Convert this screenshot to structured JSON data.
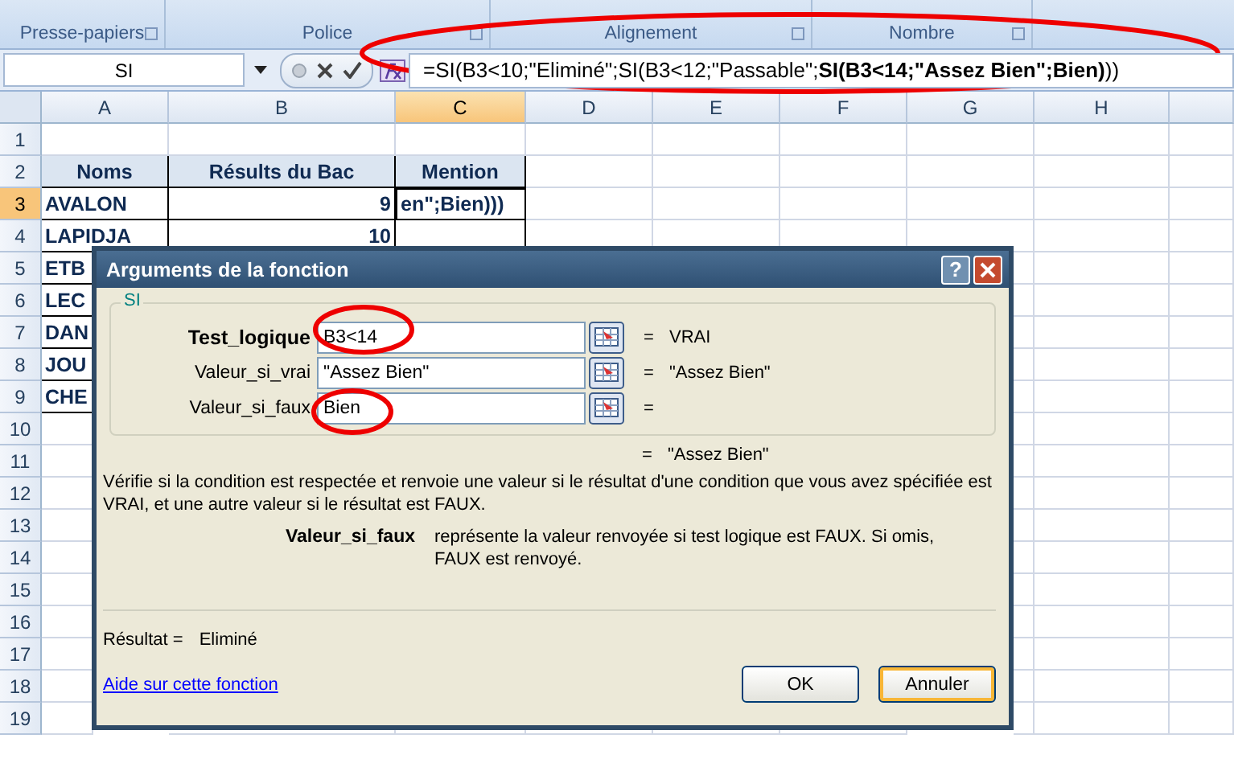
{
  "ribbon": {
    "groups": [
      {
        "label": "Presse-papiers",
        "launcher": true
      },
      {
        "label": "Police",
        "launcher": true
      },
      {
        "label": "Alignement",
        "launcher": true
      },
      {
        "label": "Nombre",
        "launcher": true
      }
    ]
  },
  "formula_bar": {
    "name_box": "SI",
    "formula": "=SI(B3<10;\"Eliminé\";SI(B3<12;\"Passable\";**SI(B3<14;\"Assez Bien\";Bien)**))"
  },
  "sheet": {
    "columns": [
      {
        "label": "A",
        "selected": false
      },
      {
        "label": "B",
        "selected": false
      },
      {
        "label": "C",
        "selected": true
      },
      {
        "label": "D",
        "selected": false
      },
      {
        "label": "E",
        "selected": false
      },
      {
        "label": "F",
        "selected": false
      },
      {
        "label": "G",
        "selected": false
      },
      {
        "label": "H",
        "selected": false
      }
    ],
    "rows": [
      {
        "label": "1",
        "selected": false
      },
      {
        "label": "2",
        "selected": false,
        "kind": "header",
        "A": "Noms",
        "B": "Résults du Bac",
        "C": "Mention"
      },
      {
        "label": "3",
        "selected": true,
        "A": "AVALON",
        "B": "9",
        "C": "en\";Bien)))",
        "editing": true
      },
      {
        "label": "4",
        "selected": false,
        "A": "LAPIDJA",
        "B": "10"
      },
      {
        "label": "5",
        "selected": false,
        "A": "ETB"
      },
      {
        "label": "6",
        "selected": false,
        "A": "LEC"
      },
      {
        "label": "7",
        "selected": false,
        "A": "DAN"
      },
      {
        "label": "8",
        "selected": false,
        "A": "JOU"
      },
      {
        "label": "9",
        "selected": false,
        "A": "CHE"
      },
      {
        "label": "10",
        "selected": false
      },
      {
        "label": "11",
        "selected": false
      },
      {
        "label": "12",
        "selected": false
      },
      {
        "label": "13",
        "selected": false
      },
      {
        "label": "14",
        "selected": false
      },
      {
        "label": "15",
        "selected": false
      },
      {
        "label": "16",
        "selected": false
      },
      {
        "label": "17",
        "selected": false
      },
      {
        "label": "18",
        "selected": false
      },
      {
        "label": "19",
        "selected": false
      }
    ]
  },
  "dialog": {
    "title": "Arguments de la fonction",
    "help_button": "?",
    "function_name": "SI",
    "arguments": [
      {
        "label": "Test_logique",
        "bold": true,
        "value": "B3<14",
        "equals": "=",
        "result": "VRAI"
      },
      {
        "label": "Valeur_si_vrai",
        "bold": false,
        "value": "\"Assez Bien\"",
        "equals": "=",
        "result": "\"Assez Bien\""
      },
      {
        "label": "Valeur_si_faux",
        "bold": false,
        "value": "Bien",
        "equals": "="
      }
    ],
    "formula_equals": "=",
    "formula_result": "\"Assez Bien\"",
    "description": "Vérifie si la condition est respectée et renvoie une valeur si le résultat d'une condition que vous avez spécifiée est VRAI, et une autre valeur si le résultat est FAUX.",
    "argument_help": {
      "name": "Valeur_si_faux",
      "text": "représente la valeur renvoyée si test logique est FAUX. Si omis, FAUX est renvoyé."
    },
    "result_label": "Résultat =",
    "result_value": "Eliminé",
    "help_link": "Aide sur cette fonction",
    "buttons": [
      {
        "label": "OK",
        "focused": false
      },
      {
        "label": "Annuler",
        "focused": true
      }
    ]
  }
}
